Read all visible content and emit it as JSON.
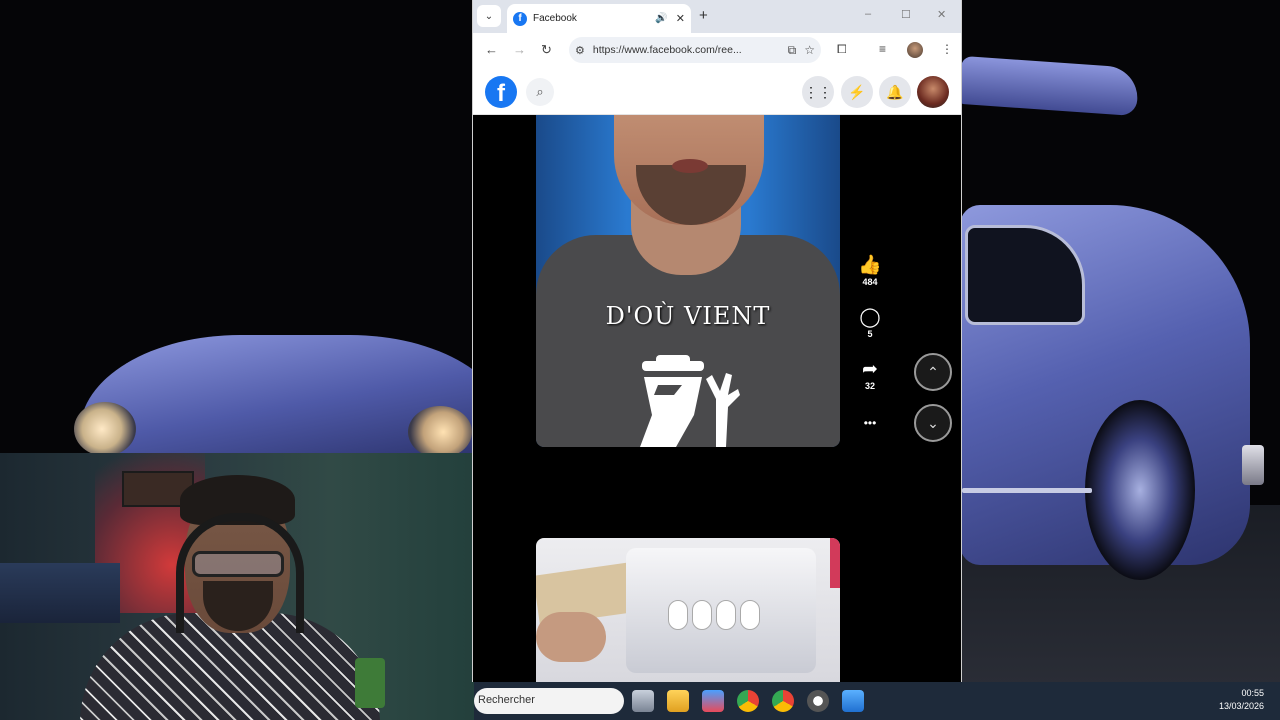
{
  "browser": {
    "tab_dropdown_icon": "chevron-down-icon",
    "tab": {
      "title": "Facebook",
      "audio_icon": "speaker-icon",
      "close_icon": "x-icon"
    },
    "new_tab_icon": "plus-icon",
    "window_controls": {
      "minimize": "–",
      "maximize": "☐",
      "close": "✕"
    },
    "address": {
      "url": "https://www.facebook.com/ree..."
    }
  },
  "facebook": {
    "logo": "f",
    "icons": [
      "grid-menu-icon",
      "messenger-icon",
      "bell-icon"
    ]
  },
  "reel": {
    "caption": "D'OÙ VIENT",
    "likes": "484",
    "comments": "5",
    "shares": "32",
    "more": "•••"
  },
  "taskbar": {
    "search_placeholder": "Rechercher",
    "time": "00:55",
    "date": "13/03/2026"
  }
}
